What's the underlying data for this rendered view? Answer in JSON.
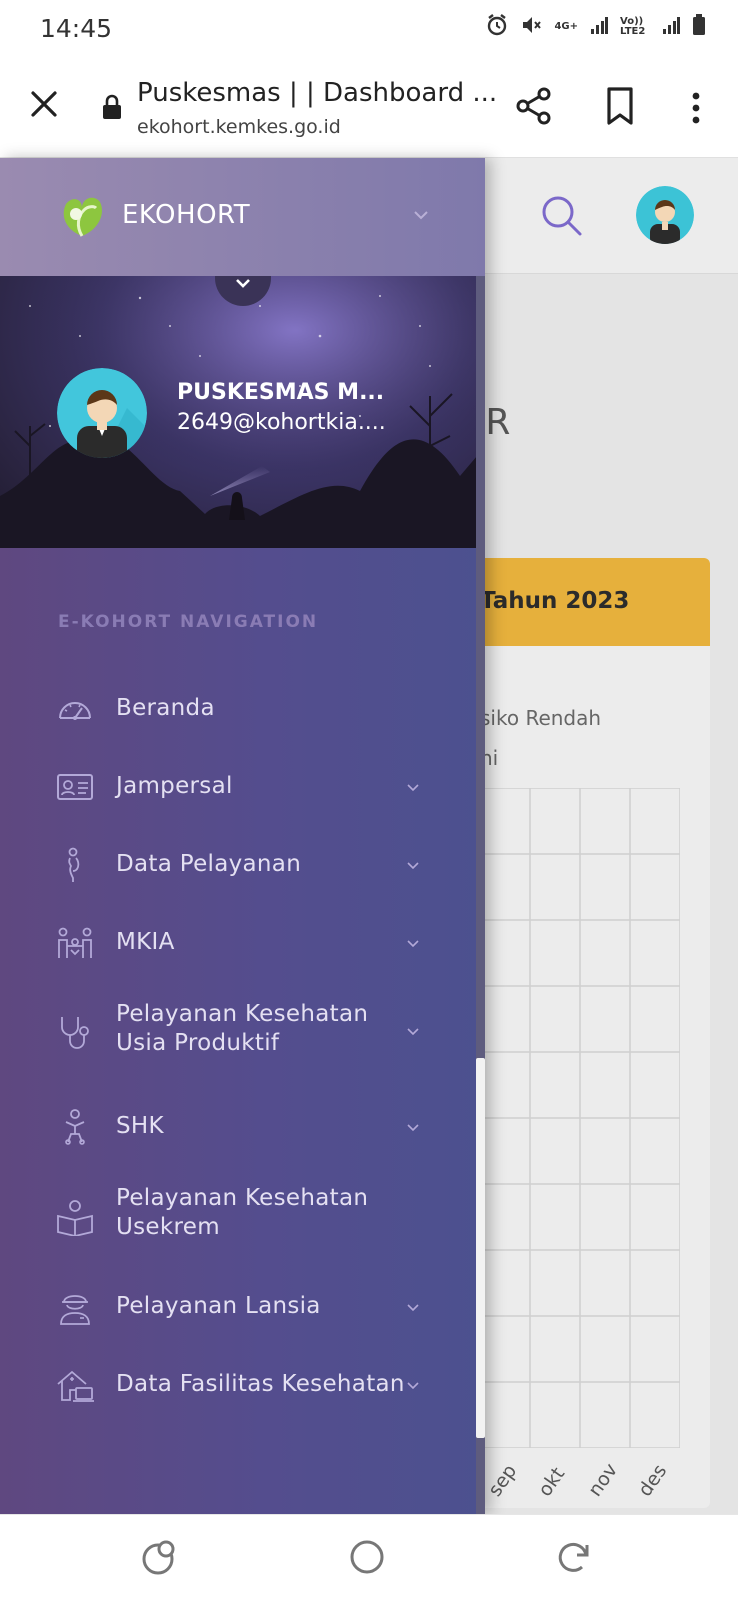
{
  "status_bar": {
    "time": "14:45",
    "network1": "4G+",
    "network2": "Vo)) LTE2"
  },
  "browser": {
    "page_title": "Puskesmas | | Dashboard ...",
    "host": "ekohort.kemkes.go.id"
  },
  "background_page": {
    "heading": "MEKAR",
    "card_title": "Tahun 2023",
    "legend_items": [
      "siko Rendah",
      "ni"
    ],
    "chart_data": {
      "type": "line",
      "categories": [
        "sep",
        "okt",
        "nov",
        "des"
      ],
      "series": []
    }
  },
  "drawer": {
    "brand": "EKOHORT",
    "user": {
      "name": "PUSKESMAS M...",
      "email": "2649@kohortkia...."
    },
    "nav_label": "E-KOHORT NAVIGATION",
    "items": [
      {
        "label": "Beranda",
        "icon": "speedometer-icon",
        "has_submenu": false
      },
      {
        "label": "Jampersal",
        "icon": "id-card-icon",
        "has_submenu": true
      },
      {
        "label": "Data Pelayanan",
        "icon": "pregnant-woman-icon",
        "has_submenu": true
      },
      {
        "label": "MKIA",
        "icon": "family-icon",
        "has_submenu": true
      },
      {
        "label": "Pelayanan Kesehatan Usia Produktif",
        "icon": "stethoscope-icon",
        "has_submenu": true
      },
      {
        "label": "SHK",
        "icon": "baby-icon",
        "has_submenu": true
      },
      {
        "label": "Pelayanan Kesehatan Usekrem",
        "icon": "student-book-icon",
        "has_submenu": false
      },
      {
        "label": "Pelayanan Lansia",
        "icon": "elderly-icon",
        "has_submenu": true
      },
      {
        "label": "Data Fasilitas Kesehatan",
        "icon": "facility-icon",
        "has_submenu": true
      }
    ]
  },
  "colors": {
    "drawer_start": "#5f4880",
    "drawer_end": "#4c518f",
    "card_header": "#e6b03c",
    "nav_text": "#e4e0f2",
    "nav_label": "#8a7cb4"
  }
}
